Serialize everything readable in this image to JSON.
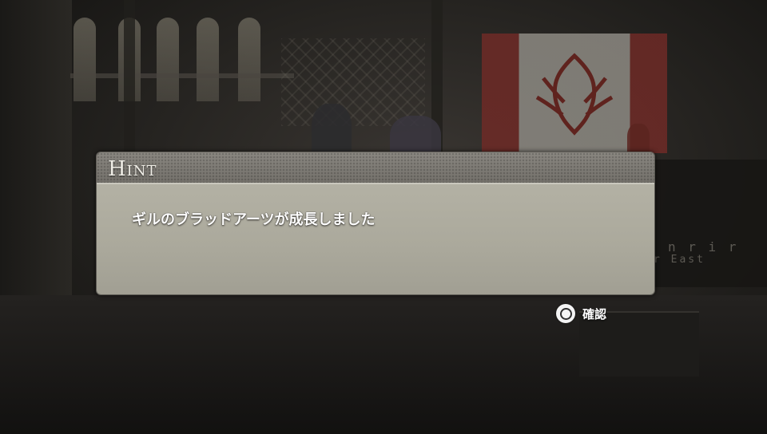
{
  "hint_dialog": {
    "title": "Hint",
    "message": "ギルのブラッドアーツが成長しました"
  },
  "prompt": {
    "button_icon": "circle-button-icon",
    "label": "確認"
  },
  "background": {
    "sign_line_1": "n r i r",
    "sign_line_2": "r  East"
  },
  "colors": {
    "header": "#7f7c76",
    "body": "#aca99d",
    "text": "#ffffff"
  }
}
